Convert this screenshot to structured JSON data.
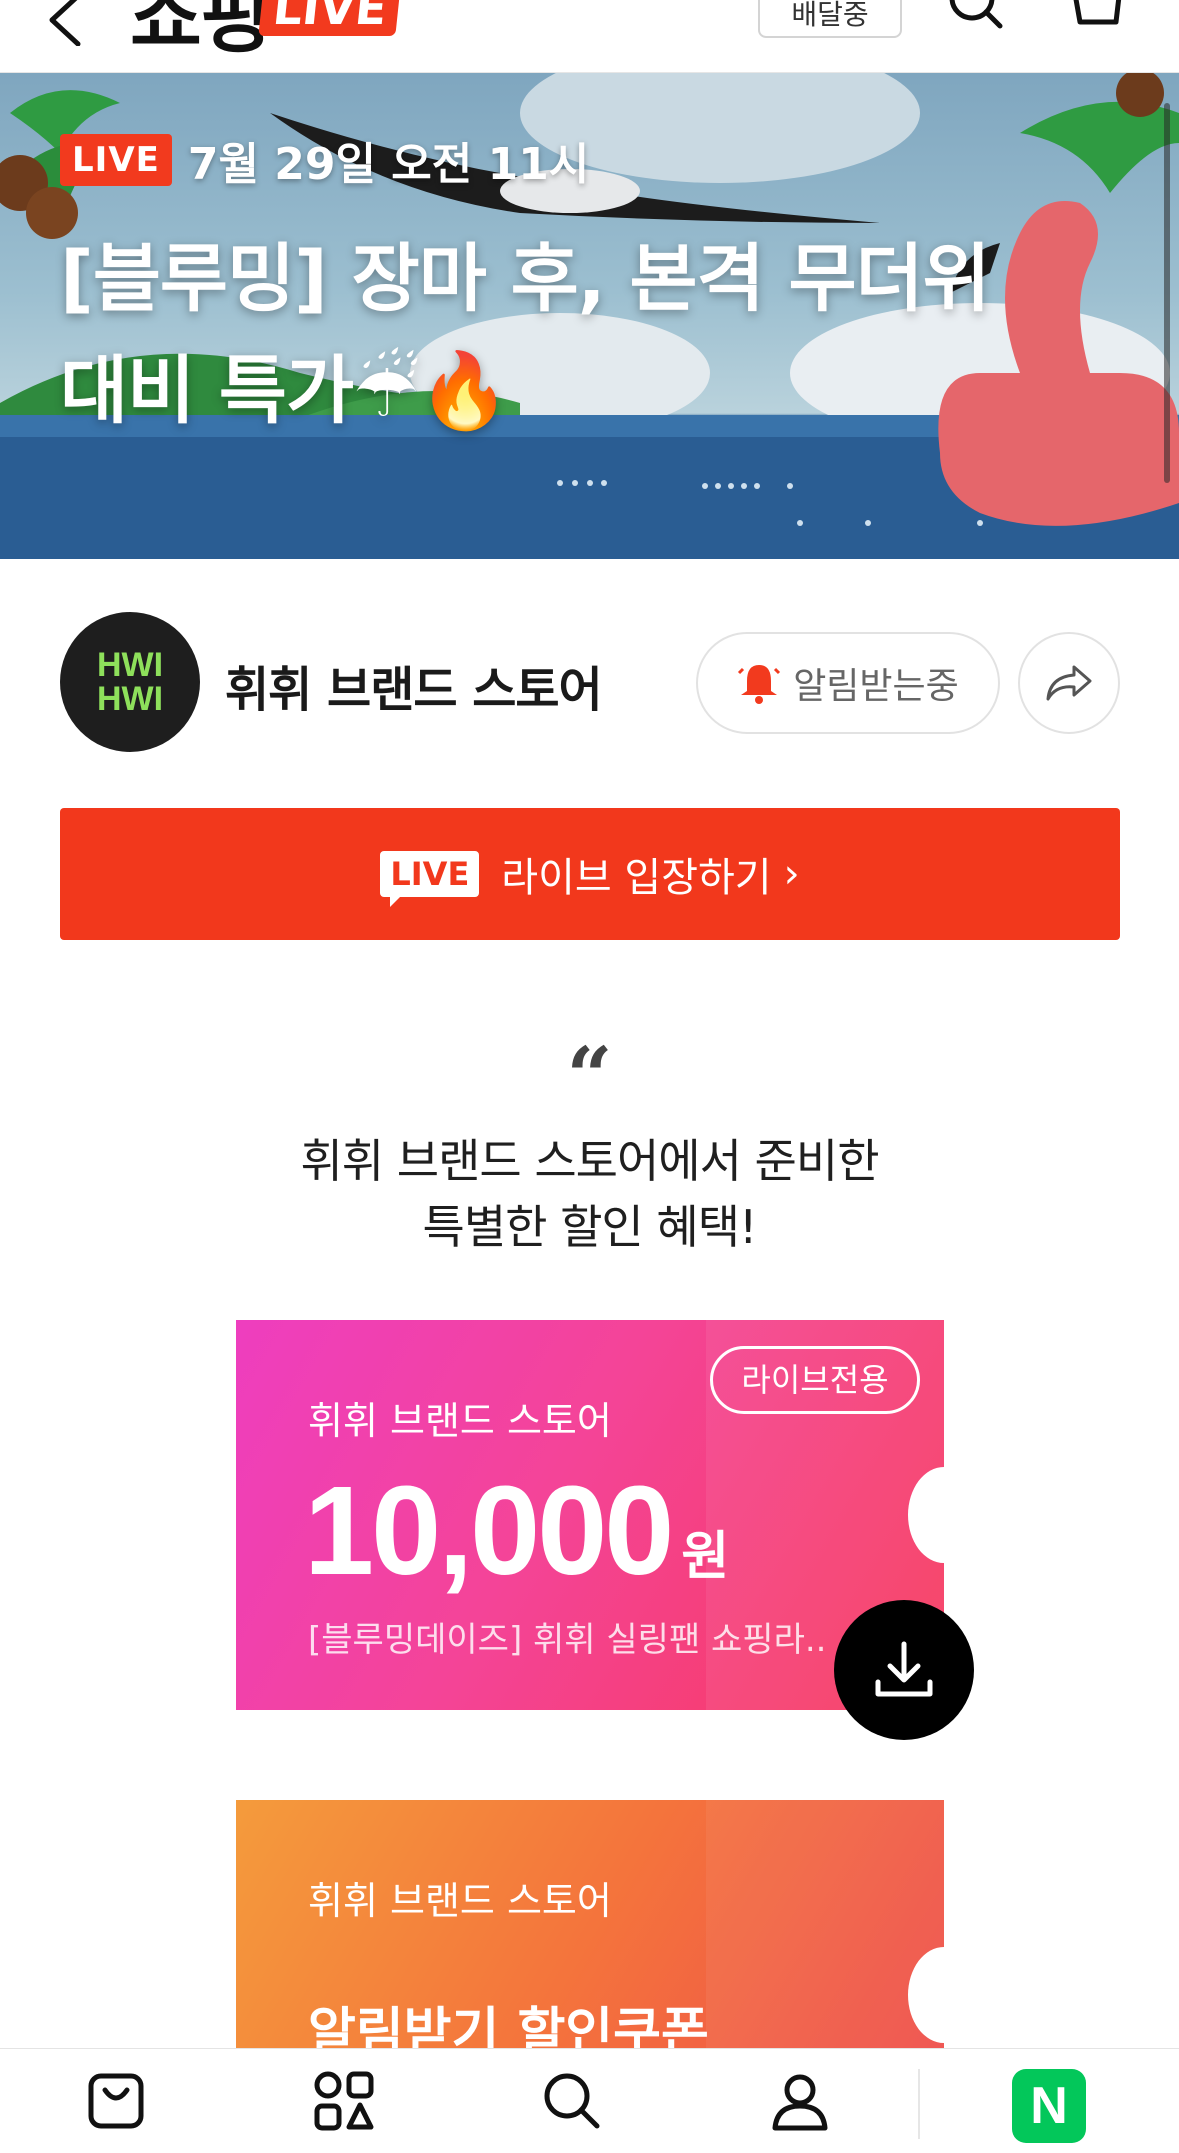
{
  "header": {
    "logo_text": "쇼핑",
    "logo_live": "LIVE",
    "shipping_button": "배달중",
    "icons": [
      "back-icon",
      "search-icon",
      "cart-icon"
    ]
  },
  "hero": {
    "live_badge": "LIVE",
    "date": "7월 29일 오전 11시",
    "title_line1": "[블루밍] 장마 후, 본격 무더위",
    "title_line2": "대비 특가☔🔥"
  },
  "store": {
    "avatar_line1": "HWI",
    "avatar_line2": "HWI",
    "name": "휘휘 브랜드 스토어",
    "notify_label": "알림받는중"
  },
  "enter_live": {
    "tag": "LIVE",
    "label": "라이브 입장하기",
    "chevron": "›"
  },
  "quote": {
    "mark": "“",
    "line1": "휘휘 브랜드 스토어에서 준비한",
    "line2": "특별한 할인 혜택!"
  },
  "coupons": [
    {
      "badge": "라이브전용",
      "store": "휘휘 브랜드 스토어",
      "amount": "10,000",
      "unit": "원",
      "description": "[블루밍데이즈] 휘휘 실링팬 쇼핑라..."
    },
    {
      "store": "휘휘 브랜드 스토어",
      "title": "알림받기 할인쿠폰"
    }
  ],
  "bottom_nav": {
    "items": [
      "shopping-bag-icon",
      "category-icon",
      "search-icon",
      "profile-icon"
    ],
    "naver": "N"
  },
  "colors": {
    "live_red": "#f23a1e",
    "coupon_pink": "#f44497",
    "coupon_orange": "#f4743c",
    "naver_green": "#03c75a"
  }
}
